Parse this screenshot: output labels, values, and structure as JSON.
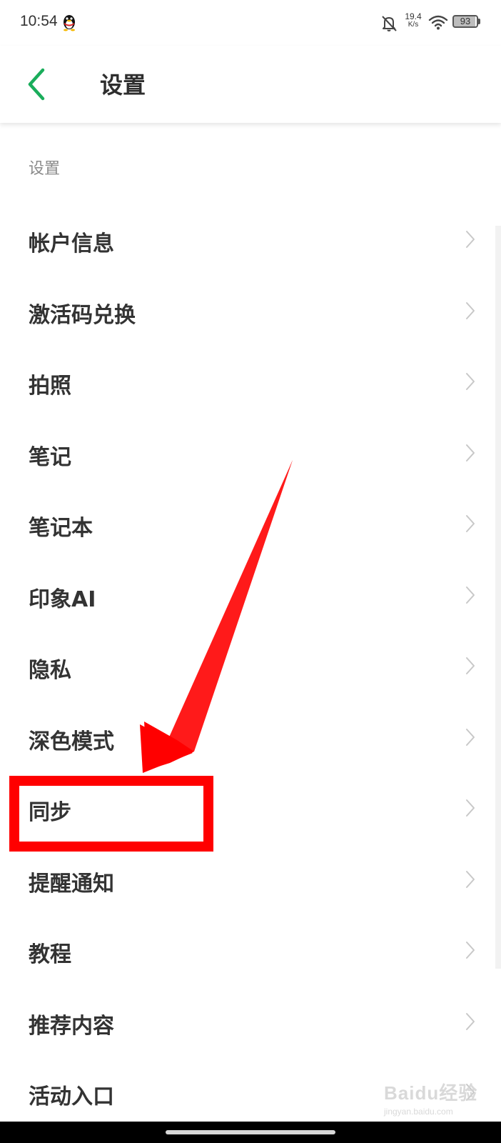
{
  "status_bar": {
    "time": "10:54",
    "net_speed_value": "19.4",
    "net_speed_unit": "K/s",
    "battery": "93",
    "icons": [
      "qq-penguin-icon",
      "mute-bell-icon",
      "wifi-icon",
      "battery-icon"
    ]
  },
  "header": {
    "title": "设置",
    "back_icon": "chevron-left-icon",
    "accent_color": "#1aad5b"
  },
  "section": {
    "label": "设置"
  },
  "menu": {
    "items": [
      {
        "label": "帐户信息"
      },
      {
        "label": "激活码兑换"
      },
      {
        "label": "拍照"
      },
      {
        "label": "笔记"
      },
      {
        "label": "笔记本"
      },
      {
        "label": "印象AI"
      },
      {
        "label": "隐私"
      },
      {
        "label": "深色模式"
      },
      {
        "label": "同步"
      },
      {
        "label": "提醒通知"
      },
      {
        "label": "教程"
      },
      {
        "label": "推荐内容"
      },
      {
        "label": "活动入口"
      }
    ]
  },
  "annotation": {
    "highlighted_item": "同步",
    "color": "#ff0000"
  },
  "watermark": {
    "main": "Baidu经验",
    "sub": "jingyan.baidu.com"
  }
}
